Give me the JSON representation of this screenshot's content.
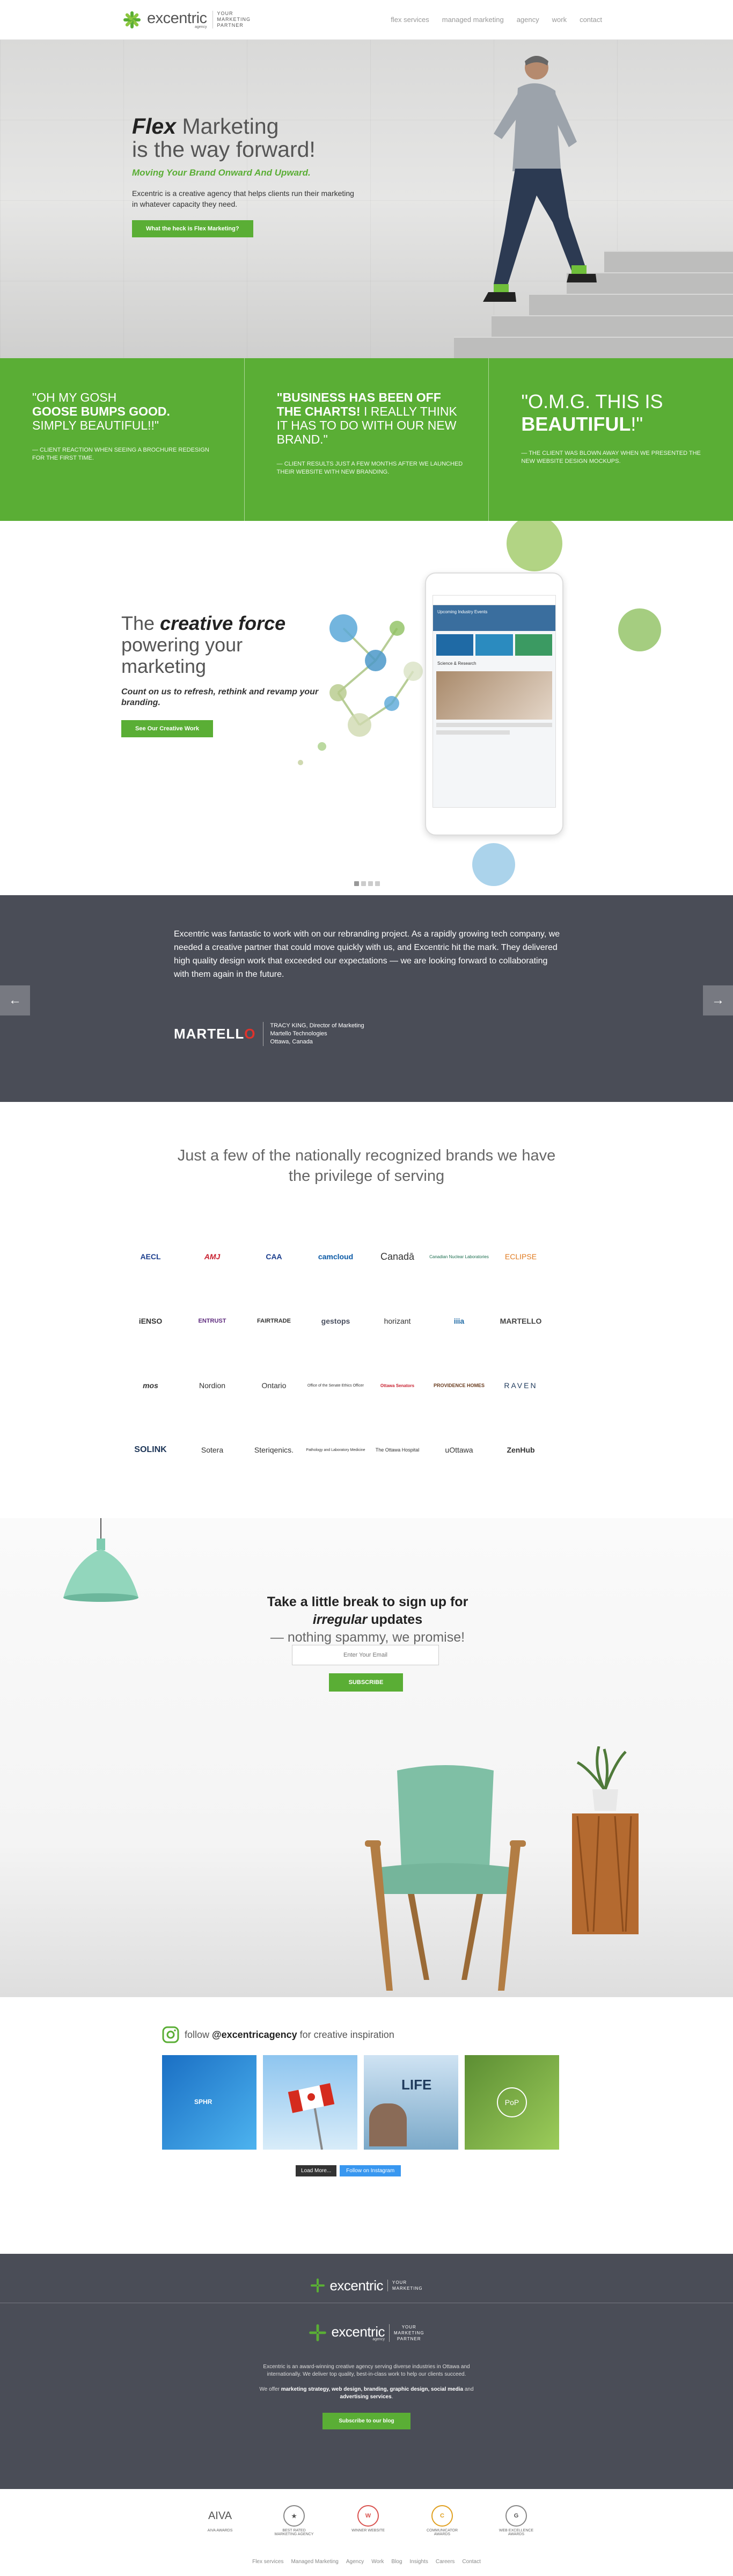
{
  "header": {
    "logo_word": "excentric",
    "logo_sub": "agency",
    "logo_tag": [
      "YOUR",
      "MARKETING",
      "PARTNER"
    ],
    "nav": [
      "flex services",
      "managed marketing",
      "agency",
      "work",
      "contact"
    ]
  },
  "hero": {
    "title_bold": "Flex",
    "title_rest": " Marketing",
    "title_line2": "is the way forward!",
    "subtitle": "Moving Your Brand Onward And Upward.",
    "description": "Excentric is a creative agency that helps clients run their marketing in whatever capacity they need.",
    "button": "What the heck is Flex Marketing?"
  },
  "quotes": [
    {
      "lines": [
        "\"OH MY GOSH",
        "GOOSE BUMPS GOOD.",
        "SIMPLY BEAUTIFUL!!\""
      ],
      "cite": "— CLIENT REACTION WHEN SEEING A BROCHURE REDESIGN FOR THE FIRST TIME."
    },
    {
      "lines": [
        "\"BUSINESS HAS BEEN OFF",
        "THE CHARTS!",
        " I REALLY THINK IT HAS TO DO WITH OUR NEW BRAND.\""
      ],
      "cite": "— CLIENT RESULTS JUST A FEW MONTHS AFTER WE LAUNCHED THEIR WEBSITE WITH NEW BRANDING."
    },
    {
      "lines": [
        "\"O.M.G. THIS IS",
        "BEAUTIFUL",
        "!\""
      ],
      "cite": "— THE CLIENT WAS BLOWN AWAY WHEN WE PRESENTED THE NEW WEBSITE DESIGN MOCKUPS."
    }
  ],
  "creative": {
    "title_pre": "The ",
    "title_bold": "creative force",
    "title_rest": "powering your marketing",
    "subtitle": "Count on us to refresh, rethink and revamp your branding.",
    "button": "See Our Creative Work",
    "tablet_heading": "Upcoming Industry Events",
    "tablet_section": "Science & Research"
  },
  "testimonial": {
    "body": "Excentric was fantastic to work with on our rebranding project. As a rapidly growing tech company, we needed a creative partner that could move quickly with us, and Excentric hit the mark. They delivered high quality design work that exceeded our expectations — we are looking forward to collaborating with them again in the future.",
    "brand": "MARTELL",
    "cite": [
      "TRACY KING, Director of Marketing",
      "Martello Technologies",
      "Ottawa, Canada"
    ],
    "prev": "←",
    "next": "→"
  },
  "brands": {
    "title": "Just a few of the nationally recognized brands we have the privilege of serving",
    "logos": [
      "AECL",
      "AMJ",
      "CAA",
      "camcloud",
      "Canadā",
      "Canadian Nuclear Laboratories",
      "ECLIPSE",
      "",
      "iENSO",
      "ENTRUST",
      "FAIRTRADE",
      "gestops",
      "horizant",
      "iiia",
      "MARTELLO",
      "",
      "mos",
      "Nordion",
      "Ontario",
      "Office of the Senate Ethics Officer",
      "Ottawa Senators",
      "PROVIDENCE HOMES",
      "RAVEN",
      "",
      "SOLINK",
      "Sotera",
      "Steriqenics.",
      "Pathology and Laboratory Medicine",
      "The Ottawa Hospital",
      "uOttawa",
      "ZenHub",
      ""
    ]
  },
  "signup": {
    "title_pre": "Take a little break to sign up for",
    "title_italic": "irregular",
    "title_post": " updates",
    "subtitle": "— nothing spammy, we promise!",
    "placeholder": "Enter Your Email",
    "button": "SUBSCRIBE"
  },
  "instagram": {
    "pre": "follow ",
    "handle": "@excentricagency",
    "post": " for creative inspiration",
    "tile_labels": [
      "SPHR",
      "",
      "LIFE",
      "PoP"
    ],
    "load_more": "Load More...",
    "follow": "Follow on Instagram"
  },
  "footer": {
    "about": "Excentric is an award-winning creative agency serving diverse industries in Ottawa and internationally. We deliver top quality, best-in-class work to help our clients succeed.",
    "offer_pre": "We offer ",
    "offer_items": "marketing strategy, web design, branding, graphic design, social media",
    "offer_and": " and ",
    "offer_last": "advertising services",
    "offer_end": ".",
    "button": "Subscribe to our blog",
    "awards": [
      {
        "mark": "AIVA",
        "label": "AIVA AWARDS"
      },
      {
        "mark": "★",
        "label": "BEST RATED MARKETING AGENCY"
      },
      {
        "mark": "W",
        "label": "WINNER WEBSITE"
      },
      {
        "mark": "C",
        "label": "COMMUNICATOR AWARDS"
      },
      {
        "mark": "G",
        "label": "WEB EXCELLENCE AWARDS"
      }
    ],
    "links": [
      "Flex services",
      "Managed Marketing",
      "Agency",
      "Work",
      "Blog",
      "Insights",
      "Careers",
      "Contact"
    ]
  }
}
